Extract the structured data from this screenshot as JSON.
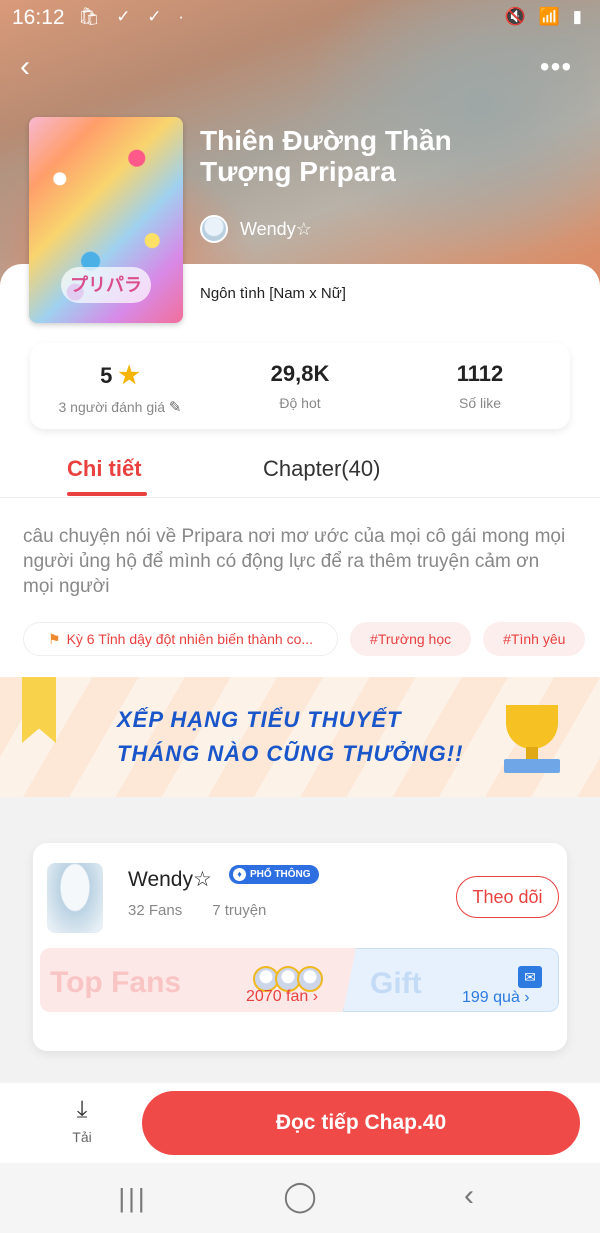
{
  "status": {
    "time": "16:12",
    "left_icons": "🛍 ✓ ✓ ·",
    "right_icons": "🔇 📶 ▮"
  },
  "header": {
    "title": "Thiên Đường Thần Tượng Pripara",
    "author": "Wendy☆",
    "genre": "Ngôn tình [Nam x Nữ]",
    "cover_logo": "プリパラ",
    "more_label": "•••",
    "back_label": "‹"
  },
  "stats": [
    {
      "value": "5",
      "label": "3 người đánh giá"
    },
    {
      "value": "29,8K",
      "label": "Độ hot"
    },
    {
      "value": "1112",
      "label": "Số like"
    }
  ],
  "tabs": [
    {
      "label": "Chi tiết"
    },
    {
      "label": "Chapter(40)"
    }
  ],
  "description": "câu chuyện nói về Pripara nơi mơ ước của mọi cô gái mong mọi người ủng hộ để mình có động lực để ra thêm truyện cảm ơn mọi người",
  "tags": [
    {
      "label": "Kỳ 6 Tỉnh dậy đột nhiên biến thành co..."
    },
    {
      "label": "#Trường học"
    },
    {
      "label": "#Tình yêu"
    }
  ],
  "banner": {
    "line1": "XẾP HẠNG TIỂU THUYẾT",
    "line2": "THÁNG NÀO CŨNG THƯỞNG!!"
  },
  "author_card": {
    "name": "Wendy☆",
    "badge": "PHỔ THÔNG",
    "fans": "32 Fans",
    "stories": "7 truyện",
    "follow": "Theo dõi",
    "top_fans_title": "Top Fans",
    "top_fans_count": "2070 fan ›",
    "gift_title": "Gift",
    "gift_count": "199 quà ›"
  },
  "bottom": {
    "download_label": "Tải",
    "read_button": "Đọc tiếp Chap.40"
  },
  "navbar": {
    "recent": "|||",
    "home": "◯",
    "back": "‹"
  },
  "colors": {
    "accent": "#e8413f",
    "star": "#f5b400",
    "badge": "#2d6fe0"
  }
}
